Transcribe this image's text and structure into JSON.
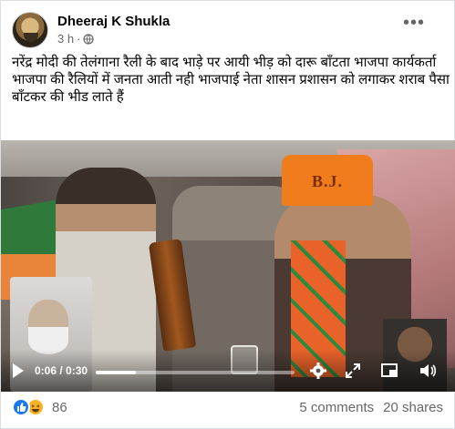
{
  "post": {
    "author": "Dheeraj K Shukla",
    "time": "3 h",
    "audience_icon": "globe-icon",
    "menu_icon": "more-horizontal-icon",
    "text_lines": [
      "नरेंद्र मोदी की तेलंगाना रैली के बाद भाड़े पर आयी भीड़ को दारू बाँटता भाजपा कार्यकर्ता",
      "भाजपा की रैलियों में जनता आती नही भाजपाई नेता शासन प्रशासन को लगाकर शराब पैसा बाँटकर की भीड लाते हैं"
    ]
  },
  "video": {
    "cap_text": "B.J.",
    "current_time": "0:06",
    "separator": " / ",
    "duration": "0:30",
    "progress": 0.2,
    "icons": [
      "play-icon",
      "settings-icon",
      "fullscreen-icon",
      "picture-in-picture-icon",
      "volume-icon"
    ]
  },
  "footer": {
    "reaction_icons": [
      "like-icon",
      "haha-icon"
    ],
    "reaction_count": "86",
    "comments": "5 comments",
    "shares": "20 shares"
  },
  "colors": {
    "like": "#1877f2",
    "haha": "#f7b125",
    "text_secondary": "#65676b",
    "cap": "#f07c1b"
  }
}
